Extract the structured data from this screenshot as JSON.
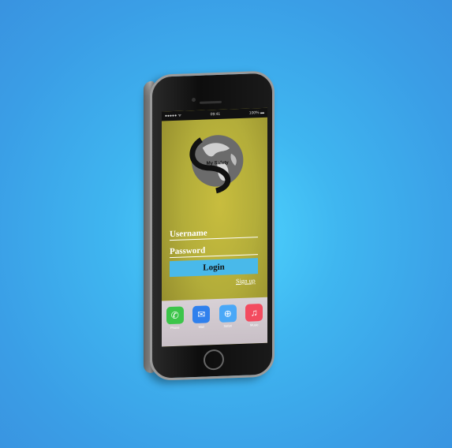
{
  "status_bar": {
    "left": "●●●●● ᯤ",
    "time": "09:41",
    "battery": "100% ▬"
  },
  "logo": {
    "text": "My Safety"
  },
  "form": {
    "username_placeholder": "Username",
    "password_placeholder": "Password",
    "login_label": "Login",
    "signup_label": "Sign up"
  },
  "dock": {
    "apps": [
      {
        "label": "Phone",
        "icon": "phone-icon",
        "color": "#3cc54a"
      },
      {
        "label": "Mail",
        "icon": "mail-icon",
        "color": "#2f80ed"
      },
      {
        "label": "Safari",
        "icon": "safari-icon",
        "color": "#4aa8f7"
      },
      {
        "label": "Music",
        "icon": "music-icon",
        "color": "#f34b5f"
      }
    ]
  },
  "colors": {
    "background": "#3fb6f0",
    "login_button": "#49b9ea",
    "screen": "#b3ad3a"
  }
}
